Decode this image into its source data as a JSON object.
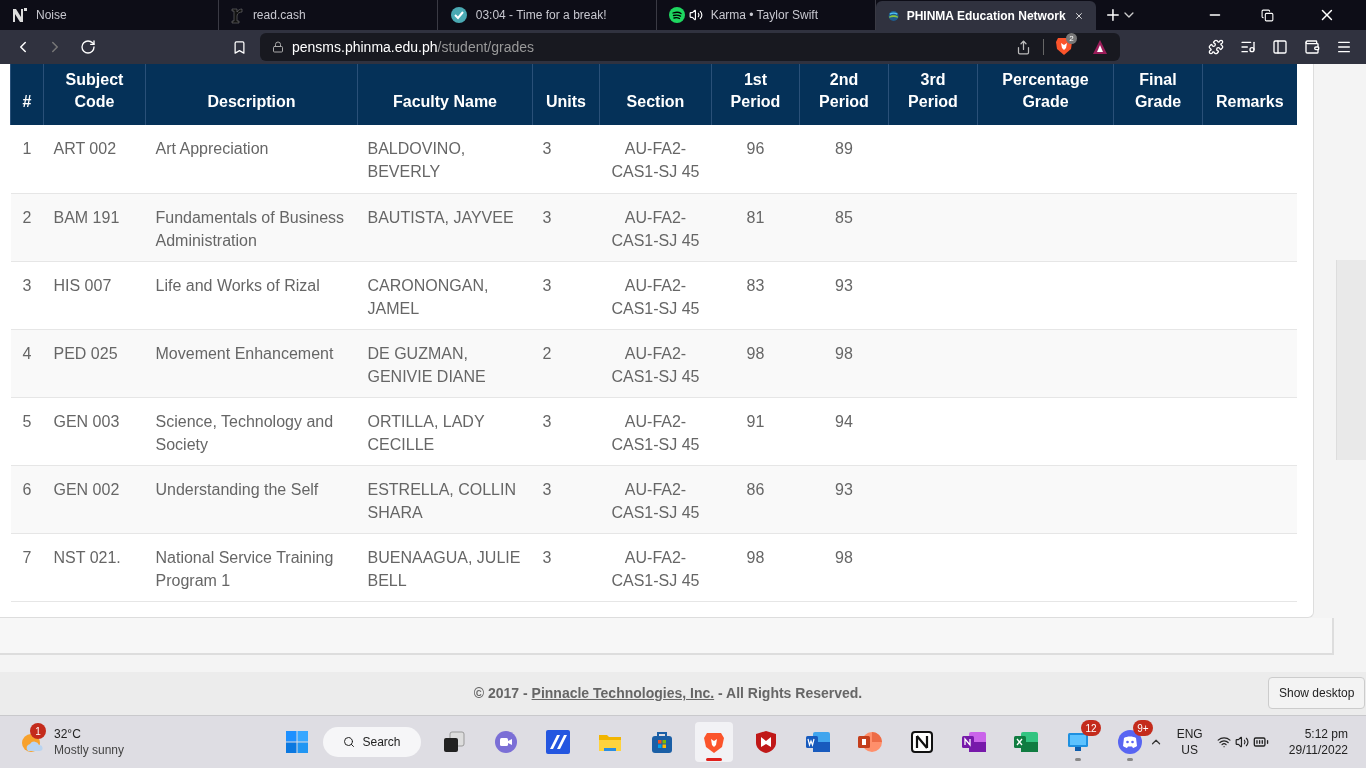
{
  "browser_tabs": [
    {
      "kind": "noise",
      "title": "Noise",
      "selected": false,
      "audio": false
    },
    {
      "kind": "readcash",
      "title": "read.cash",
      "selected": false,
      "audio": false
    },
    {
      "kind": "timer",
      "title": "03:04 - Time for a break!",
      "selected": false,
      "audio": false
    },
    {
      "kind": "spotify",
      "title": "Karma • Taylor Swift",
      "selected": false,
      "audio": true
    },
    {
      "kind": "phinma",
      "title": "PHINMA Education Network",
      "selected": true,
      "audio": false
    }
  ],
  "address_bar": {
    "domain": "pensms.phinma.edu.ph",
    "path": "/student/grades",
    "shield_count": "2"
  },
  "table": {
    "columns": [
      "#",
      "Subject Code",
      "Description",
      "Faculty Name",
      "Units",
      "Section",
      "1st Period",
      "2nd Period",
      "3rd Period",
      "Percentage Grade",
      "Final Grade",
      "Remarks"
    ],
    "rows": [
      [
        "1",
        "ART 002",
        "Art Appreciation",
        "BALDOVINO, BEVERLY",
        "3",
        "AU-FA2-CAS1-SJ 45",
        "96",
        "89"
      ],
      [
        "2",
        "BAM 191",
        "Fundamentals of Business Administration",
        "BAUTISTA, JAYVEE",
        "3",
        "AU-FA2-CAS1-SJ 45",
        "81",
        "85"
      ],
      [
        "3",
        "HIS 007",
        "Life and Works of Rizal",
        "CARONONGAN, JAMEL",
        "3",
        "AU-FA2-CAS1-SJ 45",
        "83",
        "93"
      ],
      [
        "4",
        "PED 025",
        "Movement Enhancement",
        "DE GUZMAN, GENIVIE DIANE",
        "2",
        "AU-FA2-CAS1-SJ 45",
        "98",
        "98"
      ],
      [
        "5",
        "GEN 003",
        "Science, Technology and Society",
        "ORTILLA, LADY CECILLE",
        "3",
        "AU-FA2-CAS1-SJ 45",
        "91",
        "94"
      ],
      [
        "6",
        "GEN 002",
        "Understanding the Self",
        "ESTRELLA, COLLIN SHARA",
        "3",
        "AU-FA2-CAS1-SJ 45",
        "86",
        "93"
      ],
      [
        "7",
        "NST 021.",
        "National Service Training Program 1",
        "BUENAAGUA, JULIE BELL",
        "3",
        "AU-FA2-CAS1-SJ 45",
        "98",
        "98"
      ]
    ]
  },
  "footer": {
    "prefix": "© 2017 - ",
    "link": "Pinnacle Technologies, Inc.",
    "suffix": " - All Rights Reserved."
  },
  "tooltip": "Show desktop",
  "taskbar": {
    "weather": {
      "badge": "1",
      "temperature": "32°C",
      "condition": "Mostly sunny"
    },
    "search": "Search",
    "apps": [
      {
        "kind": "taskview",
        "selected": false,
        "running": false
      },
      {
        "kind": "meet",
        "selected": false,
        "running": false
      },
      {
        "kind": "mapp",
        "selected": false,
        "running": false
      },
      {
        "kind": "folder",
        "selected": false,
        "running": false
      },
      {
        "kind": "store",
        "selected": false,
        "running": false
      },
      {
        "kind": "brave",
        "selected": true,
        "running": true
      },
      {
        "kind": "mcafee",
        "selected": false,
        "running": false
      },
      {
        "kind": "word",
        "selected": false,
        "running": false
      },
      {
        "kind": "powerpoint",
        "selected": false,
        "running": false
      },
      {
        "kind": "notion",
        "selected": false,
        "running": false
      },
      {
        "kind": "onenote",
        "selected": false,
        "running": false
      },
      {
        "kind": "excel",
        "selected": false,
        "running": false
      },
      {
        "kind": "remote",
        "selected": false,
        "running": true,
        "badge": "12"
      },
      {
        "kind": "discord",
        "selected": false,
        "running": true,
        "badge": "9+"
      }
    ],
    "language": "ENG",
    "region": "US",
    "time": "5:12 pm",
    "date": "29/11/2022"
  }
}
